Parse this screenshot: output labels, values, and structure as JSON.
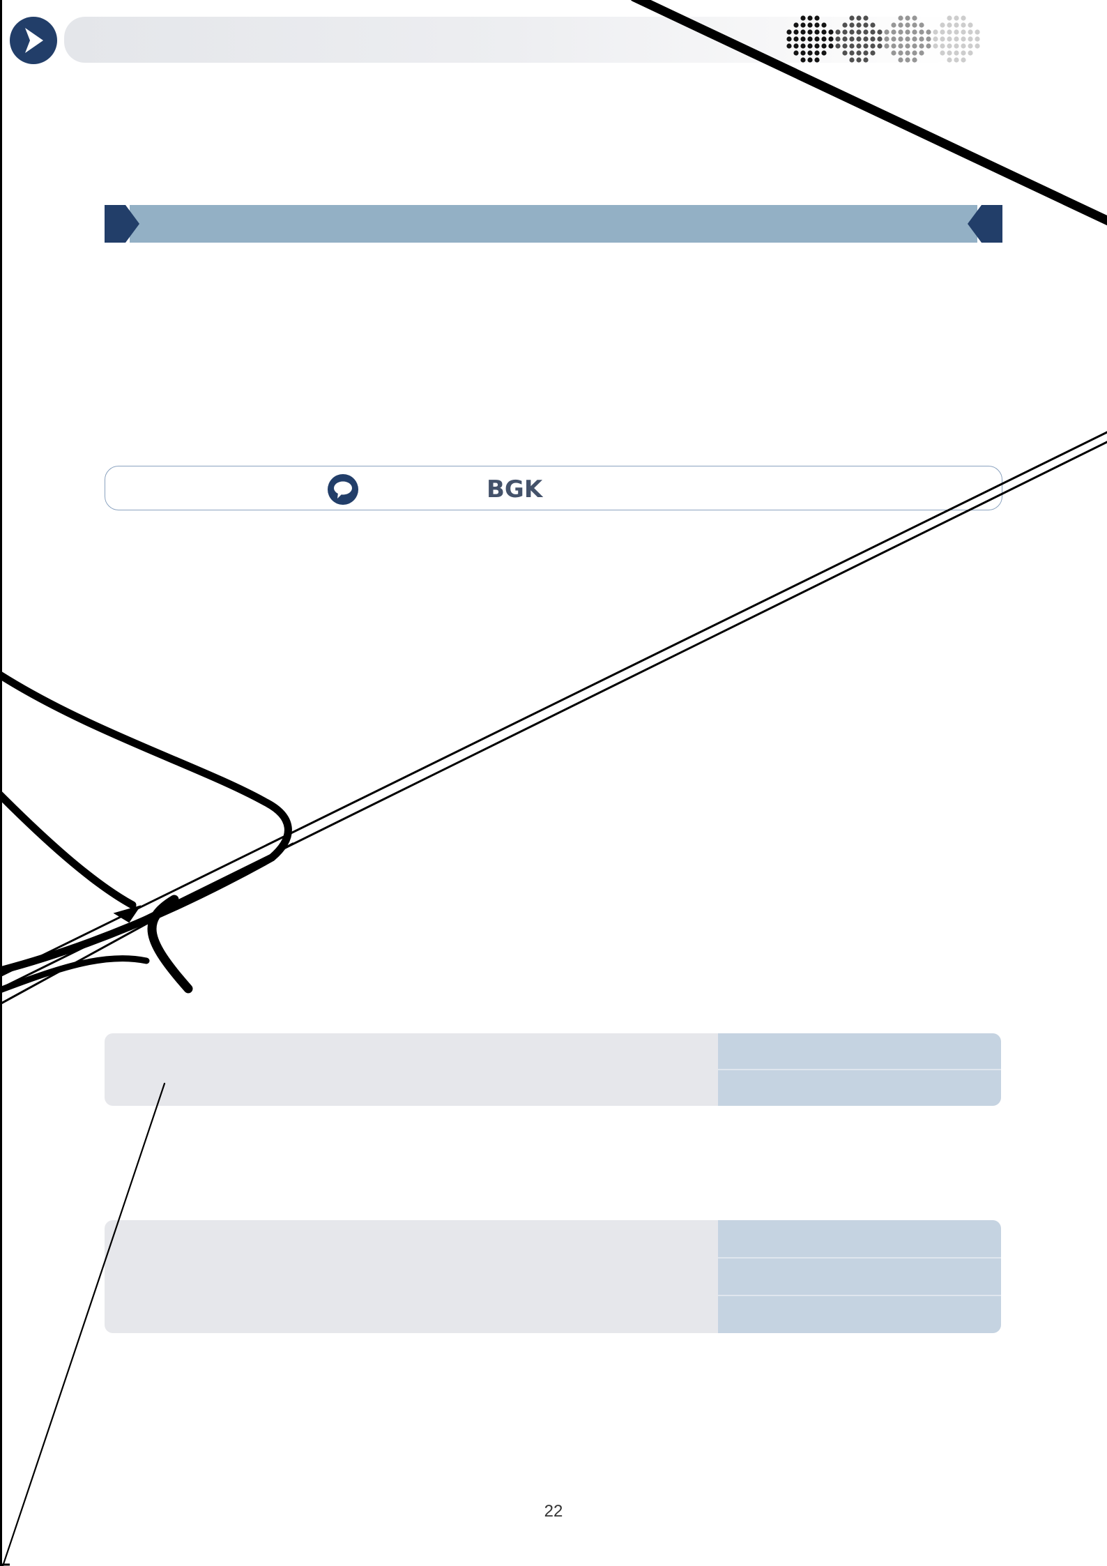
{
  "header": {
    "nav_icon": "chevron-right-icon",
    "decoration": "dot-arrow-pattern"
  },
  "section_banner": {
    "title": ""
  },
  "info_strip": {
    "icon": "chat-bubble-icon",
    "label": "BGK"
  },
  "tables": [
    {
      "rows": 2
    },
    {
      "rows": 3
    }
  ],
  "footer": {
    "page_number": "22"
  },
  "colors": {
    "navy": "#223e69",
    "banner_blue": "#93b0c5",
    "cell_blue": "#c5d3e1",
    "panel_grey": "#e6e7eb"
  }
}
